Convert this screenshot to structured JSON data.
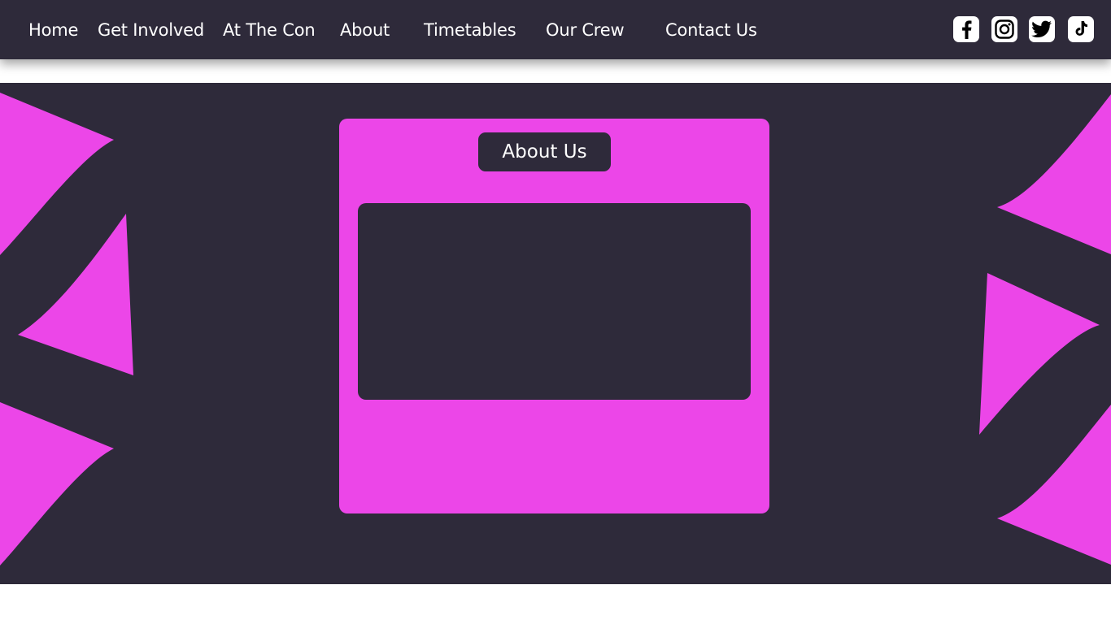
{
  "nav": {
    "home": "Home",
    "get_involved": "Get Involved",
    "at_the_con": "At The Con",
    "about": "About",
    "timetables": "Timetables",
    "our_crew": "Our Crew",
    "contact_us": "Contact Us"
  },
  "social": {
    "facebook": "facebook-icon",
    "instagram": "instagram-icon",
    "twitter": "twitter-icon",
    "tiktok": "tiktok-icon"
  },
  "main": {
    "title": "About Us"
  },
  "colors": {
    "dark": "#2e2a3a",
    "accent": "#ec46e8",
    "white": "#ffffff"
  }
}
